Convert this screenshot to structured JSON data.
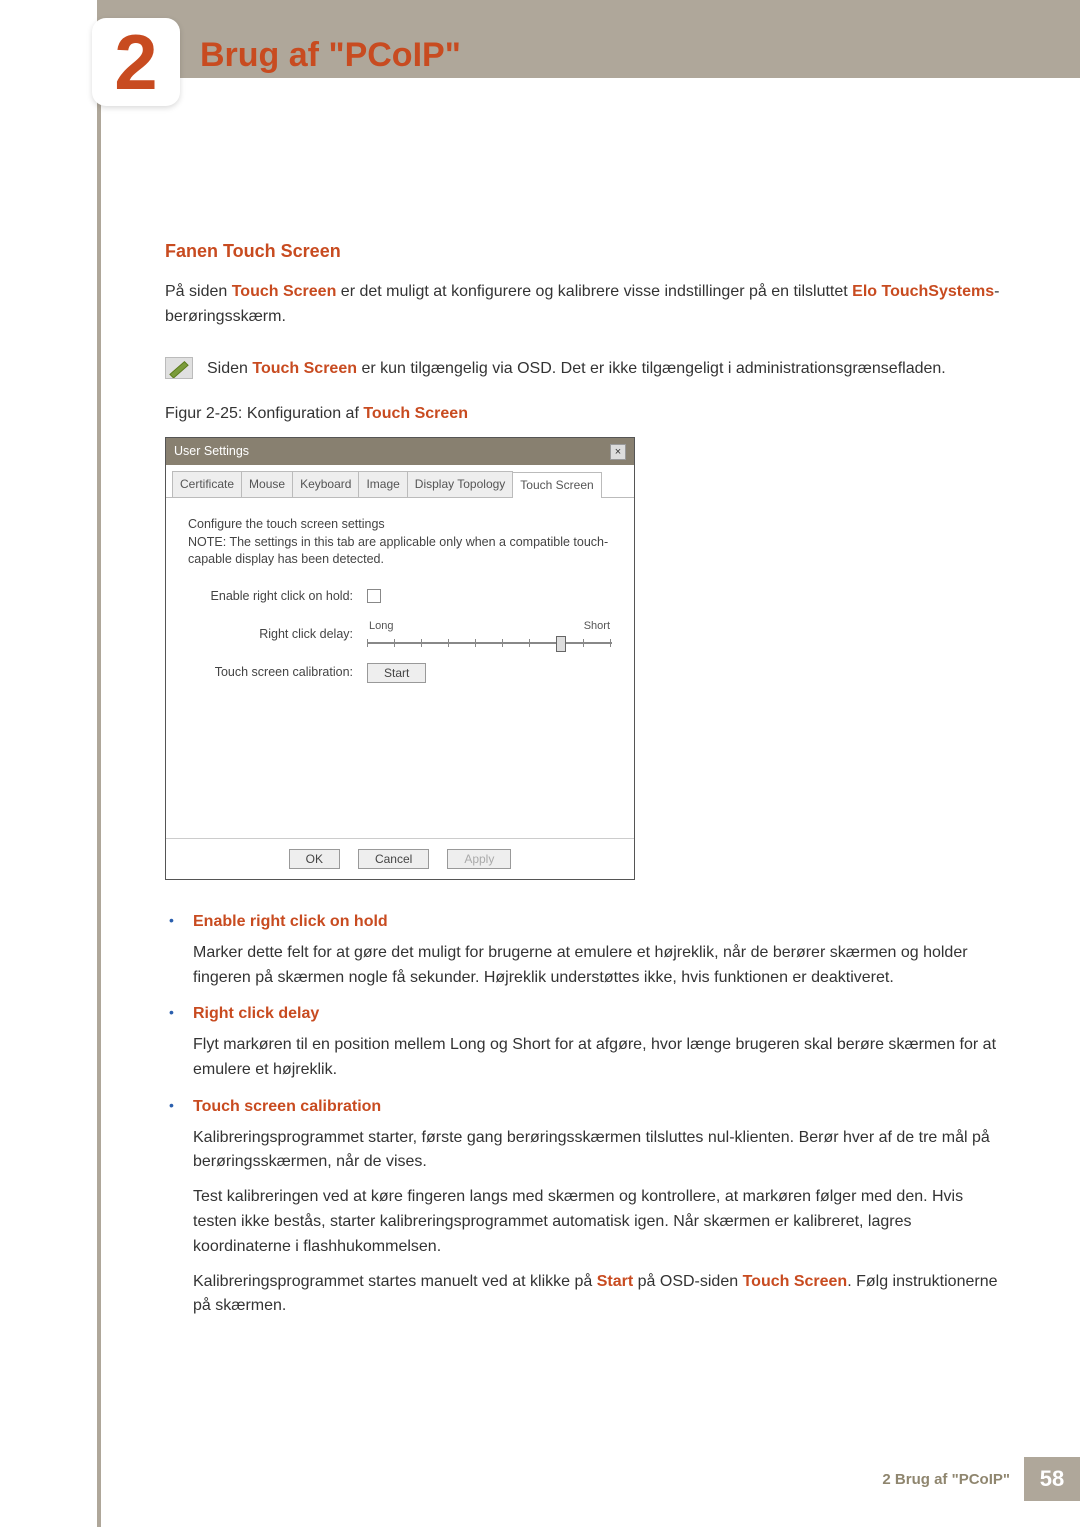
{
  "chapter_num": "2",
  "chapter_title": "Brug af \"PCoIP\"",
  "section_title": "Fanen Touch Screen",
  "intro_p1_a": "På siden ",
  "intro_p1_b": "Touch Screen",
  "intro_p1_c": " er det muligt at konfigurere og kalibrere visse indstillinger på en tilsluttet ",
  "intro_p1_d": "Elo TouchSystems",
  "intro_p1_e": "-berøringsskærm.",
  "note_a": "Siden ",
  "note_b": "Touch Screen",
  "note_c": " er kun tilgængelig via OSD. Det er ikke tilgængeligt i administrationsgrænsefladen.",
  "figcap_a": "Figur 2-25: Konfiguration af ",
  "figcap_b": "Touch Screen",
  "ss": {
    "window_title": "User Settings",
    "tabs": [
      "Certificate",
      "Mouse",
      "Keyboard",
      "Image",
      "Display Topology",
      "Touch Screen"
    ],
    "active_tab": 5,
    "desc_l1": "Configure the touch screen settings",
    "desc_l2": "NOTE: The settings in this tab are applicable only when a compatible touch-capable display has been detected.",
    "row1_label": "Enable right click on hold:",
    "row2_label": "Right click delay:",
    "row2_long": "Long",
    "row2_short": "Short",
    "row3_label": "Touch screen calibration:",
    "row3_btn": "Start",
    "ok": "OK",
    "cancel": "Cancel",
    "apply": "Apply"
  },
  "bullets": [
    {
      "title": "Enable right click on hold",
      "paras": [
        "Marker dette felt for at gøre det muligt for brugerne at emulere et højreklik, når de berører skærmen og holder fingeren på skærmen nogle få sekunder. Højreklik understøttes ikke, hvis funktionen er deaktiveret."
      ]
    },
    {
      "title": "Right click delay",
      "paras": [
        "Flyt markøren til en position mellem Long og Short for at afgøre, hvor længe brugeren skal berøre skærmen for at emulere et højreklik."
      ]
    },
    {
      "title": "Touch screen calibration",
      "paras": [
        "Kalibreringsprogrammet starter, første gang berøringsskærmen tilsluttes nul-klienten. Berør hver af de tre mål på berøringsskærmen, når de vises.",
        "Test kalibreringen ved at køre fingeren langs med skærmen og kontrollere, at markøren følger med den. Hvis testen ikke bestås, starter kalibreringsprogrammet automatisk igen. Når skærmen er kalibreret, lagres koordinaterne i flashhukommelsen."
      ],
      "last_a": "Kalibreringsprogrammet startes manuelt ved at klikke på ",
      "last_b": "Start",
      "last_c": " på OSD-siden ",
      "last_d": "Touch Screen",
      "last_e": ". Følg instruktionerne på skærmen."
    }
  ],
  "footer_label": "2 Brug af \"PCoIP\"",
  "page_num": "58"
}
